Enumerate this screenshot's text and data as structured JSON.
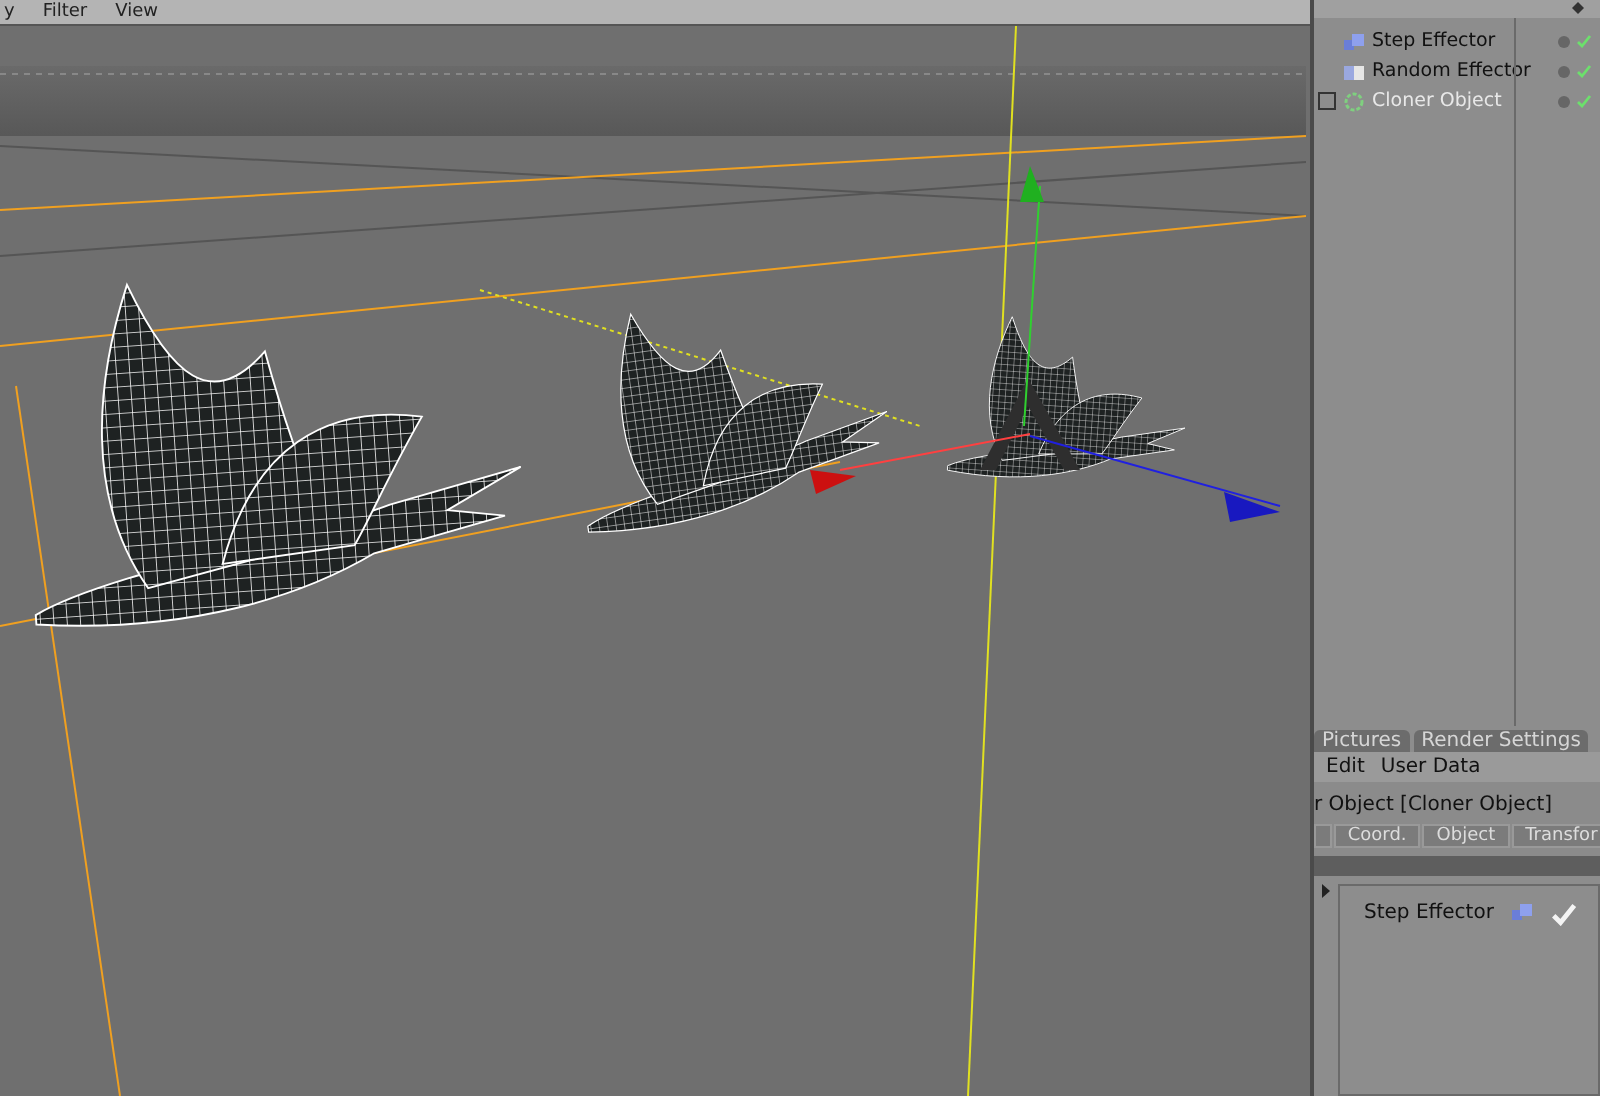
{
  "menu": [
    {
      "label": "y"
    },
    {
      "label": "Filter"
    },
    {
      "label": "View"
    }
  ],
  "objects": [
    {
      "name": "Step Effector",
      "kind": "step",
      "selected": false,
      "expandable": false,
      "enabled": true
    },
    {
      "name": "Random Effector",
      "kind": "random",
      "selected": false,
      "expandable": false,
      "enabled": true
    },
    {
      "name": "Cloner Object",
      "kind": "cloner",
      "selected": true,
      "expandable": true,
      "enabled": true
    }
  ],
  "attribute_tabs": [
    {
      "label": "Pictures"
    },
    {
      "label": "Render Settings"
    }
  ],
  "attribute_menu": [
    {
      "label": "Edit"
    },
    {
      "label": "User Data"
    }
  ],
  "attribute_title": "r Object [Cloner Object]",
  "attribute_subtabs": [
    {
      "label": "Coord."
    },
    {
      "label": "Object"
    },
    {
      "label": "Transfor"
    }
  ],
  "effectors": [
    {
      "name": "Step Effector",
      "enabled": true
    }
  ]
}
